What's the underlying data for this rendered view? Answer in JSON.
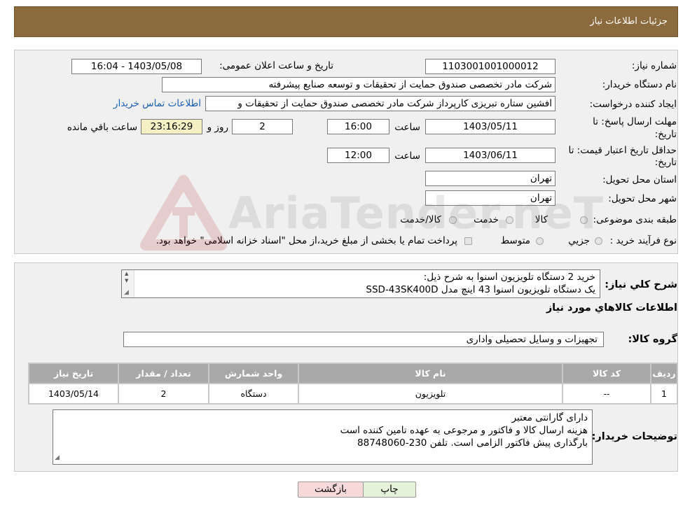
{
  "header": {
    "title": "جزئیات اطلاعات نیاز"
  },
  "form": {
    "need_number_label": "شماره نیاز:",
    "need_number": "1103001001000012",
    "announce_label": "تاریخ و ساعت اعلان عمومی:",
    "announce_value": "1403/05/08 - 16:04",
    "buyer_label": "نام دستگاه خریدار:",
    "buyer_value": "شرکت مادر تخصصی صندوق حمایت از تحقیقات و توسعه صنایع پیشرفته",
    "creator_label": "ایجاد کننده درخواست:",
    "creator_value": "افشین  ستاره تبریزی کارپرداز شرکت مادر تخصصی صندوق حمایت از تحقیقات و",
    "contact_link": "اطلاعات تماس خریدار",
    "deadline_label_1": "مهلت ارسال پاسخ: تا",
    "deadline_label_2": "تاریخ:",
    "deadline_date": "1403/05/11",
    "time_label": "ساعت",
    "deadline_time": "16:00",
    "days_value": "2",
    "days_label": "روز و",
    "remaining_value": "23:16:29",
    "remaining_label": "ساعت باقي مانده",
    "validity_label_1": "حداقل تاریخ اعتبار قیمت: تا",
    "validity_label_2": "تاریخ:",
    "validity_date": "1403/06/11",
    "validity_time": "12:00",
    "province_label": "استان محل تحویل:",
    "province_value": "تهران",
    "city_label": "شهر محل تحویل:",
    "city_value": "تهران",
    "category_label": "طبقه بندی موضوعی:",
    "category_options": [
      "کالا",
      "خدمت",
      "کالا/خدمت"
    ],
    "purchase_type_label": "نوع فرآیند خرید :",
    "purchase_options": [
      "جزيي",
      "متوسط"
    ],
    "purchase_note": "پرداخت تمام یا بخشی از مبلغ خرید،از محل \"اسناد خزانه اسلامی\" خواهد بود."
  },
  "description": {
    "label": "شرح كلي نياز:",
    "line1": "خرید 2 دستگاه تلویزیون اسنوا به شرح ذیل:",
    "line2": "یک دستگاه تلویزیون اسنوا 43 اینچ مدل SSD-43SK400D"
  },
  "goods": {
    "section_title": "اطلاعات كالاهاي مورد نياز",
    "group_label": "گروه کالا:",
    "group_value": "تجهیزات و وسایل تحصیلی واداری",
    "columns": [
      "رديف",
      "کد کالا",
      "نام کالا",
      "واحد شمارش",
      "تعداد / مقدار",
      "تاریخ نیاز"
    ],
    "row": [
      "1",
      "--",
      "تلویزیون",
      "دستگاه",
      "2",
      "1403/05/14"
    ]
  },
  "notes": {
    "label": "توضیحات خریدار:",
    "line1": "دارای گارانتی معتبر",
    "line2": "هزینه ارسال کالا و فاکتور و مرجوعی به عهده تامین کننده است",
    "line3": "بارگذاری پیش فاکتور الزامی است. تلفن 230-88748060"
  },
  "buttons": {
    "print": "چاپ",
    "back": "بازگشت"
  },
  "watermark": {
    "text": "AriaTender.neT"
  },
  "colors": {
    "header": "#8b6b3d",
    "table_header": "#a8a8a8",
    "back_button": "#f8d9d9",
    "print_button": "#e3f2d9"
  }
}
